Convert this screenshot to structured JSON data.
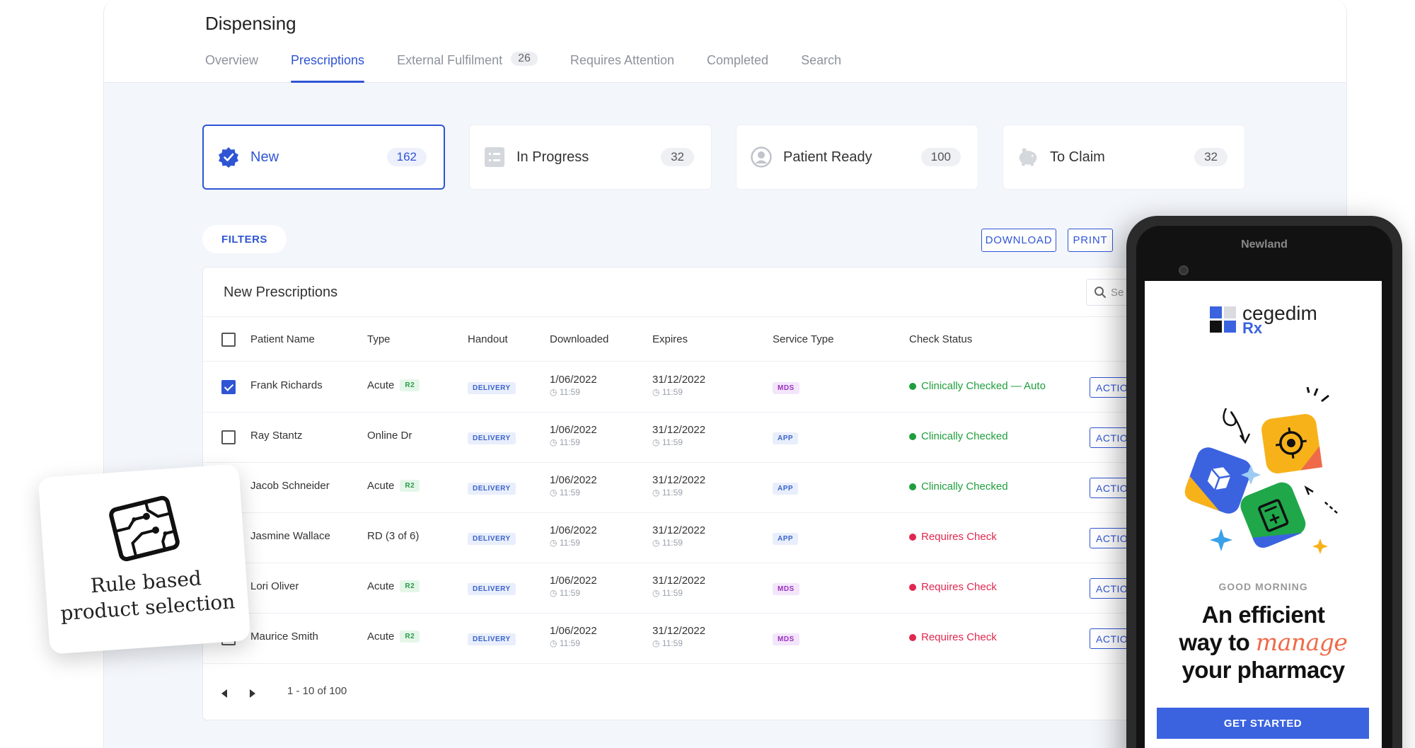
{
  "header": {
    "title": "Dispensing",
    "tabs": [
      {
        "label": "Overview"
      },
      {
        "label": "Prescriptions"
      },
      {
        "label": "External Fulfilment",
        "badge": "26"
      },
      {
        "label": "Requires Attention"
      },
      {
        "label": "Completed"
      },
      {
        "label": "Search"
      }
    ],
    "active_tab": "Prescriptions"
  },
  "status_cards": [
    {
      "label": "New",
      "count": "162",
      "icon": "verified-badge-icon"
    },
    {
      "label": "In Progress",
      "count": "32",
      "icon": "checklist-icon"
    },
    {
      "label": "Patient Ready",
      "count": "100",
      "icon": "user-circle-icon"
    },
    {
      "label": "To Claim",
      "count": "32",
      "icon": "piggy-bank-icon"
    }
  ],
  "toolbar": {
    "filters_label": "FILTERS",
    "download_label": "DOWNLOAD",
    "print_label": "PRINT"
  },
  "table": {
    "title": "New Prescriptions",
    "search_placeholder": "Se",
    "columns": [
      "Patient Name",
      "Type",
      "Handout",
      "Downloaded",
      "Expires",
      "Service Type",
      "Check Status"
    ],
    "rows": [
      {
        "checked": true,
        "name": "Frank Richards",
        "type": "Acute",
        "type_tag": "R2",
        "handout": "DELIVERY",
        "downloaded": "1/06/2022",
        "downloaded_time": "11:59",
        "expires": "31/12/2022",
        "expires_time": "11:59",
        "service": "MDS",
        "status": "Clinically Checked — Auto",
        "status_kind": "ok",
        "action": "ACTION"
      },
      {
        "checked": false,
        "name": "Ray Stantz",
        "type": "Online Dr",
        "type_tag": "",
        "handout": "DELIVERY",
        "downloaded": "1/06/2022",
        "downloaded_time": "11:59",
        "expires": "31/12/2022",
        "expires_time": "11:59",
        "service": "APP",
        "status": "Clinically Checked",
        "status_kind": "ok",
        "action": "ACTION"
      },
      {
        "checked": false,
        "name": "Jacob Schneider",
        "type": "Acute",
        "type_tag": "R2",
        "handout": "DELIVERY",
        "downloaded": "1/06/2022",
        "downloaded_time": "11:59",
        "expires": "31/12/2022",
        "expires_time": "11:59",
        "service": "APP",
        "status": "Clinically Checked",
        "status_kind": "ok",
        "action": "ACTION"
      },
      {
        "checked": false,
        "name": "Jasmine Wallace",
        "type": "RD (3 of 6)",
        "type_tag": "",
        "handout": "DELIVERY",
        "downloaded": "1/06/2022",
        "downloaded_time": "11:59",
        "expires": "31/12/2022",
        "expires_time": "11:59",
        "service": "APP",
        "status": "Requires Check",
        "status_kind": "bad",
        "action": "ACTION"
      },
      {
        "checked": false,
        "name": "Lori Oliver",
        "type": "Acute",
        "type_tag": "R2",
        "handout": "DELIVERY",
        "downloaded": "1/06/2022",
        "downloaded_time": "11:59",
        "expires": "31/12/2022",
        "expires_time": "11:59",
        "service": "MDS",
        "status": "Requires Check",
        "status_kind": "bad",
        "action": "ACTION"
      },
      {
        "checked": false,
        "name": "Maurice Smith",
        "type": "Acute",
        "type_tag": "R2",
        "handout": "DELIVERY",
        "downloaded": "1/06/2022",
        "downloaded_time": "11:59",
        "expires": "31/12/2022",
        "expires_time": "11:59",
        "service": "MDS",
        "status": "Requires Check",
        "status_kind": "bad",
        "action": "ACTION"
      }
    ],
    "pagination": "1 - 10 of 100"
  },
  "note": {
    "line1": "Rule based",
    "line2": "product selection",
    "icon": "circuit-board-icon"
  },
  "phone": {
    "brand": "Newland",
    "app_logo": "cegedim",
    "app_logo_sub": "Rx",
    "greeting": "GOOD MORNING",
    "headline_1": "An efficient",
    "headline_2": "way to",
    "headline_script": "manage",
    "headline_3": "your pharmacy",
    "cta": "GET STARTED"
  },
  "colors": {
    "accent": "#2f55d4",
    "ok": "#1f9e3d",
    "warning": "#e0284f",
    "cta": "#3b63e0"
  }
}
